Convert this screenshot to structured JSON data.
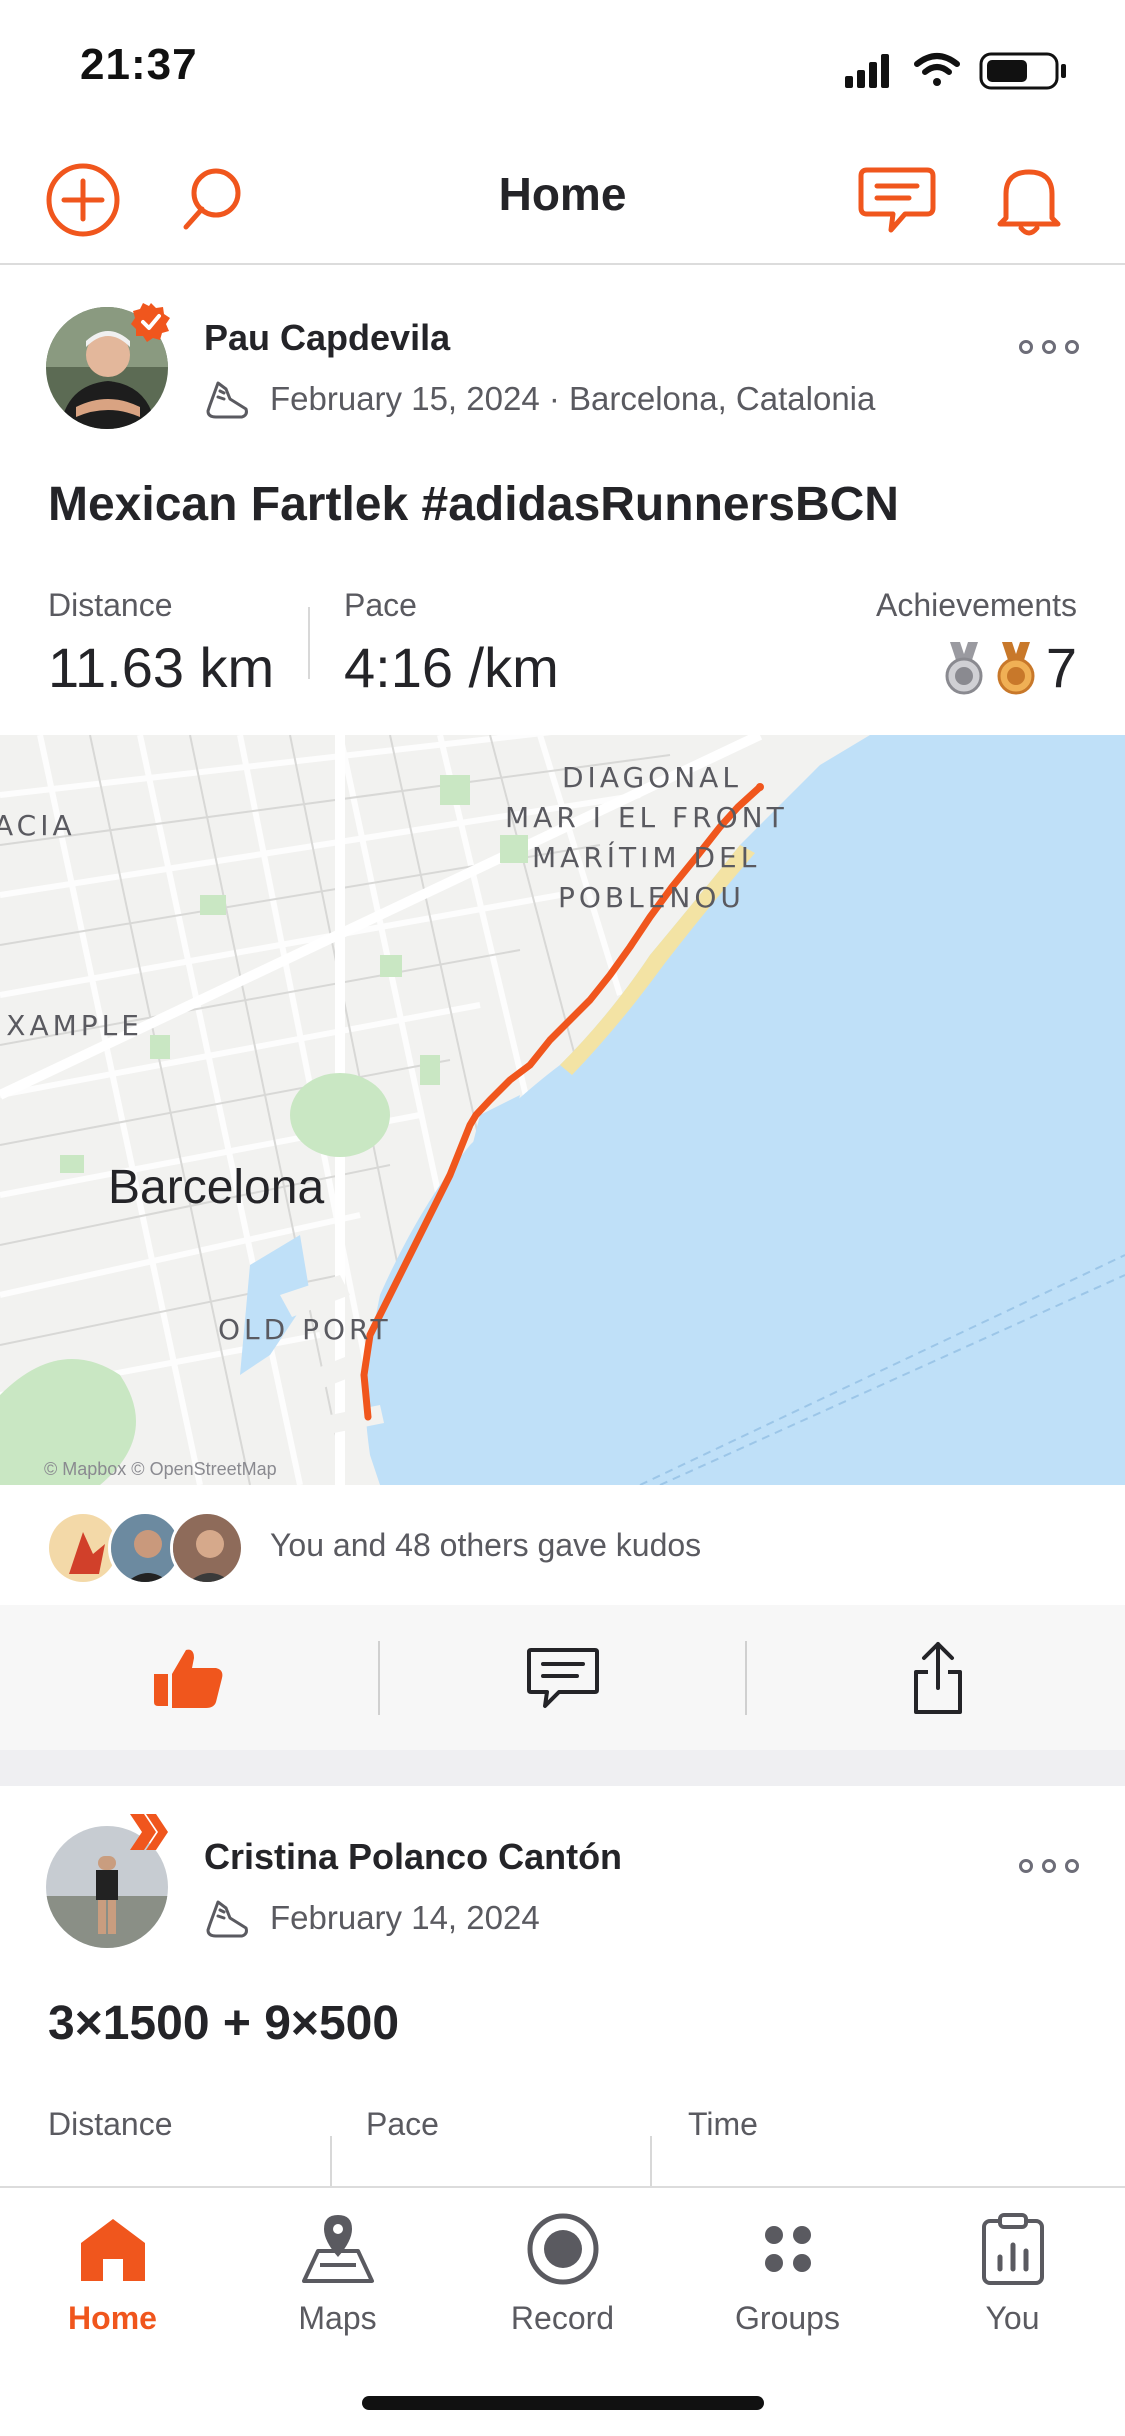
{
  "status_bar": {
    "time": "21:37"
  },
  "header": {
    "title": "Home"
  },
  "colors": {
    "accent": "#f0561d",
    "text": "#242428",
    "muted": "#5a5a60",
    "water": "#bfe0f8",
    "land": "#f2f2f0",
    "route": "#f0561d"
  },
  "posts": [
    {
      "athlete": "Pau Capdevila",
      "date_location": "February 15, 2024 · Barcelona, Catalonia",
      "title": "Mexican Fartlek #adidasRunnersBCN",
      "stats": [
        {
          "label": "Distance",
          "value": "11.63 km"
        },
        {
          "label": "Pace",
          "value": "4:16 /km"
        }
      ],
      "achievements": {
        "label": "Achievements",
        "count": "7"
      },
      "map": {
        "labels": {
          "district1": "DIAGONAL",
          "district2": "MAR I EL FRONT",
          "district3": "MARÍTIM DEL",
          "district4": "POBLENOU",
          "acia": "ACIA",
          "eixample": "IXAMPLE",
          "city": "Barcelona",
          "old_port": "OLD PORT",
          "attribution": "© Mapbox © OpenStreetMap"
        }
      },
      "kudos_text": "You and 48 others gave kudos"
    },
    {
      "athlete": "Cristina Polanco Cantón",
      "date": "February 14, 2024",
      "title": "3×1500 + 9×500",
      "stats": [
        {
          "label": "Distance"
        },
        {
          "label": "Pace"
        },
        {
          "label": "Time"
        }
      ]
    }
  ],
  "tabs": [
    {
      "label": "Home",
      "icon": "home-icon",
      "active": true
    },
    {
      "label": "Maps",
      "icon": "map-icon"
    },
    {
      "label": "Record",
      "icon": "record-icon"
    },
    {
      "label": "Groups",
      "icon": "groups-icon"
    },
    {
      "label": "You",
      "icon": "profile-icon"
    }
  ]
}
